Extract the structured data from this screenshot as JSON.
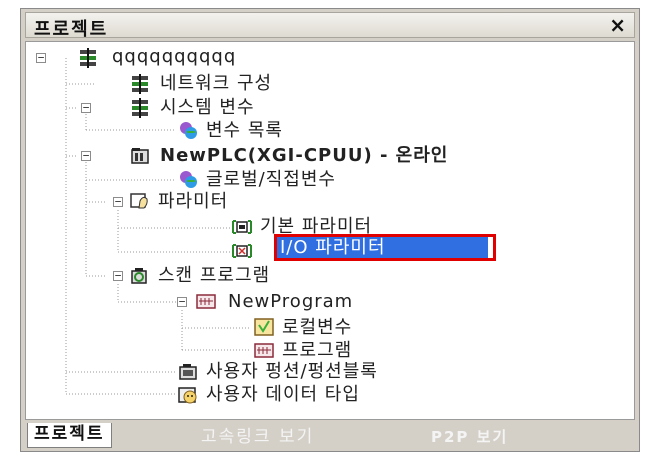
{
  "panel": {
    "title": "프로젝트",
    "close_label": "×"
  },
  "tree": {
    "items": [
      {
        "label": "qqqqqqqqqq",
        "icon": "plc-network-icon"
      },
      {
        "label": "네트워크 구성",
        "icon": "plc-network-icon"
      },
      {
        "label": "시스템 변수",
        "icon": "plc-network-icon"
      },
      {
        "label": "변수 목록",
        "icon": "variable-globe-icon"
      },
      {
        "label": "NewPLC(XGI-CPUU) - 온라인",
        "icon": "plc-cpu-icon"
      },
      {
        "label": "글로벌/직접변수",
        "icon": "variable-globe-icon"
      },
      {
        "label": "파라미터",
        "icon": "parameter-icon"
      },
      {
        "label": "기본 파라미터",
        "icon": "basic-parameter-icon"
      },
      {
        "label": "I/O 파라미터",
        "icon": "io-parameter-icon"
      },
      {
        "label": "스캔 프로그램",
        "icon": "scan-program-icon"
      },
      {
        "label": "NewProgram",
        "icon": "program-icon"
      },
      {
        "label": "로컬변수",
        "icon": "local-variable-icon"
      },
      {
        "label": "프로그램",
        "icon": "program-icon"
      },
      {
        "label": "사용자 펑션/펑션블록",
        "icon": "function-block-icon"
      },
      {
        "label": "사용자 데이터 타입",
        "icon": "user-data-type-icon"
      }
    ],
    "selected": "I/O 파라미터"
  },
  "tabs": [
    {
      "label": "프로젝트",
      "active": true
    },
    {
      "label": "고속링크 보기",
      "active": false
    },
    {
      "label": "P2P 보기",
      "active": false
    }
  ],
  "colors": {
    "selection": "#2f6fe1",
    "callout": "#e00000",
    "panel": "#d4d0c8"
  }
}
